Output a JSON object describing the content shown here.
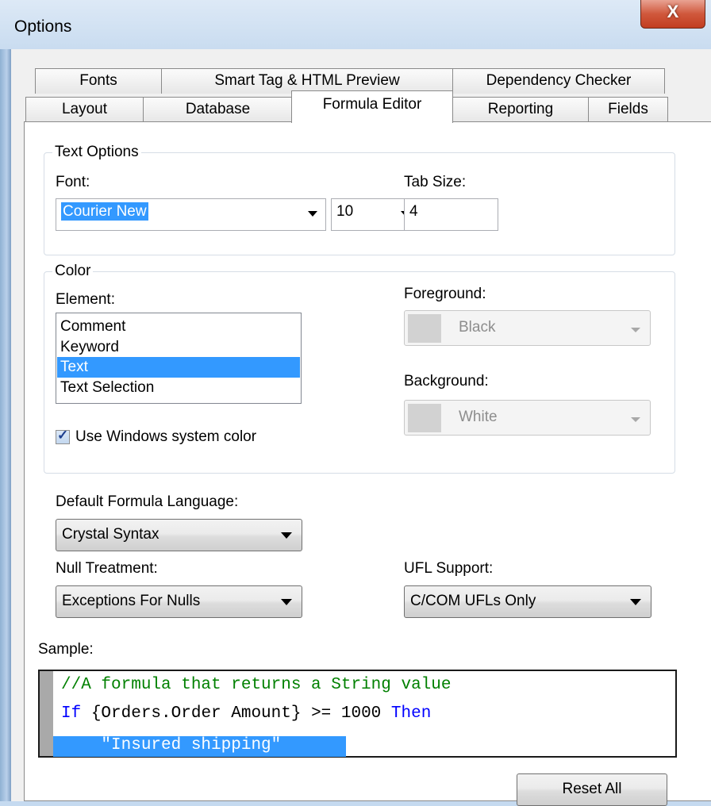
{
  "window": {
    "title": "Options",
    "close_glyph": "X"
  },
  "tabs": {
    "row_back": [
      "Fonts",
      "Smart Tag & HTML Preview",
      "Dependency Checker"
    ],
    "row_front": [
      "Layout",
      "Database",
      "Formula Editor",
      "Reporting",
      "Fields"
    ],
    "active": "Formula Editor"
  },
  "text_options": {
    "legend": "Text Options",
    "font_label": "Font:",
    "font_value": "Courier New",
    "size_value": "10",
    "tab_size_label": "Tab Size:",
    "tab_size_value": "4"
  },
  "color": {
    "legend": "Color",
    "element_label": "Element:",
    "elements": [
      "Comment",
      "Keyword",
      "Text",
      "Text Selection"
    ],
    "selected_element": "Text",
    "foreground_label": "Foreground:",
    "foreground_value": "Black",
    "background_label": "Background:",
    "background_value": "White",
    "system_color_label": "Use Windows system color",
    "system_color_checked": true
  },
  "formula": {
    "language_label": "Default Formula Language:",
    "language_value": "Crystal Syntax",
    "null_label": "Null Treatment:",
    "null_value": "Exceptions For Nulls",
    "ufl_label": "UFL Support:",
    "ufl_value": "C/COM UFLs Only"
  },
  "sample": {
    "label": "Sample:",
    "line1": "//A formula that returns a String value",
    "line2_kw1": "If",
    "line2_mid": " {Orders.Order Amount} >= 1000 ",
    "line2_kw2": "Then",
    "line3": "    \"Insured shipping\""
  },
  "buttons": {
    "reset_all": "Reset All"
  },
  "colors": {
    "selection": "#3399ff",
    "comment": "#008000",
    "keyword": "#0000ff",
    "close_button": "#c94a2d"
  }
}
